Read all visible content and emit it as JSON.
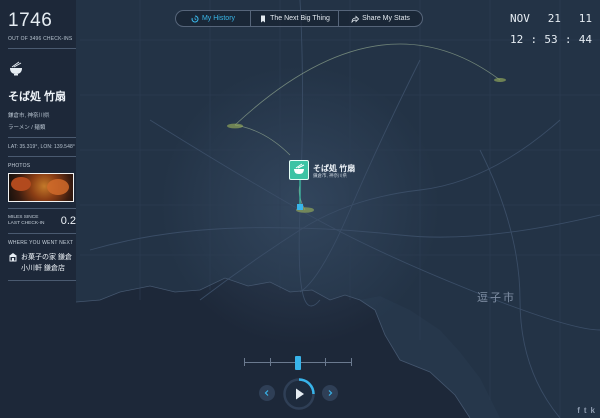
{
  "sidebar": {
    "checkin_count": "1746",
    "checkin_sub": "OUT OF 3496 CHECK-INS",
    "venue_name": "そば処 竹扇",
    "venue_location": "鎌倉市, 神奈川県",
    "venue_category": "ラーメン / 麺類",
    "coords": "LAT: 35.319°, LON: 139.548°",
    "photos_label": "PHOTOS",
    "miles_label_line1": "MILES SINCE",
    "miles_label_line2": "LAST CHECK-IN",
    "miles_value": "0.2",
    "next_label": "WHERE YOU WENT NEXT",
    "next_venue": "お菓子の家 鎌倉小川軒 鎌倉店"
  },
  "topnav": {
    "tabs": [
      {
        "label": "My History",
        "icon": "history-icon",
        "active": true
      },
      {
        "label": "The Next Big Thing",
        "icon": "bookmark-icon",
        "active": false
      },
      {
        "label": "Share My Stats",
        "icon": "share-icon",
        "active": false
      }
    ]
  },
  "clock": {
    "month": "NOV",
    "day": "21",
    "year": "11",
    "hour": "12",
    "minute": "53",
    "ampm": "44",
    "colon": ":"
  },
  "pin": {
    "title": "そば処 竹扇",
    "subtitle": "鎌倉市, 神奈川県"
  },
  "map_labels": {
    "zushi": "逗子市"
  },
  "timeline": {
    "progress": 0.5
  },
  "social": {
    "facebook": "f",
    "twitter": "t",
    "other": "k"
  },
  "colors": {
    "accent": "#38b4ea",
    "venue_green": "#3cc3a4",
    "sea": "#1b2637",
    "land": "#233347"
  }
}
